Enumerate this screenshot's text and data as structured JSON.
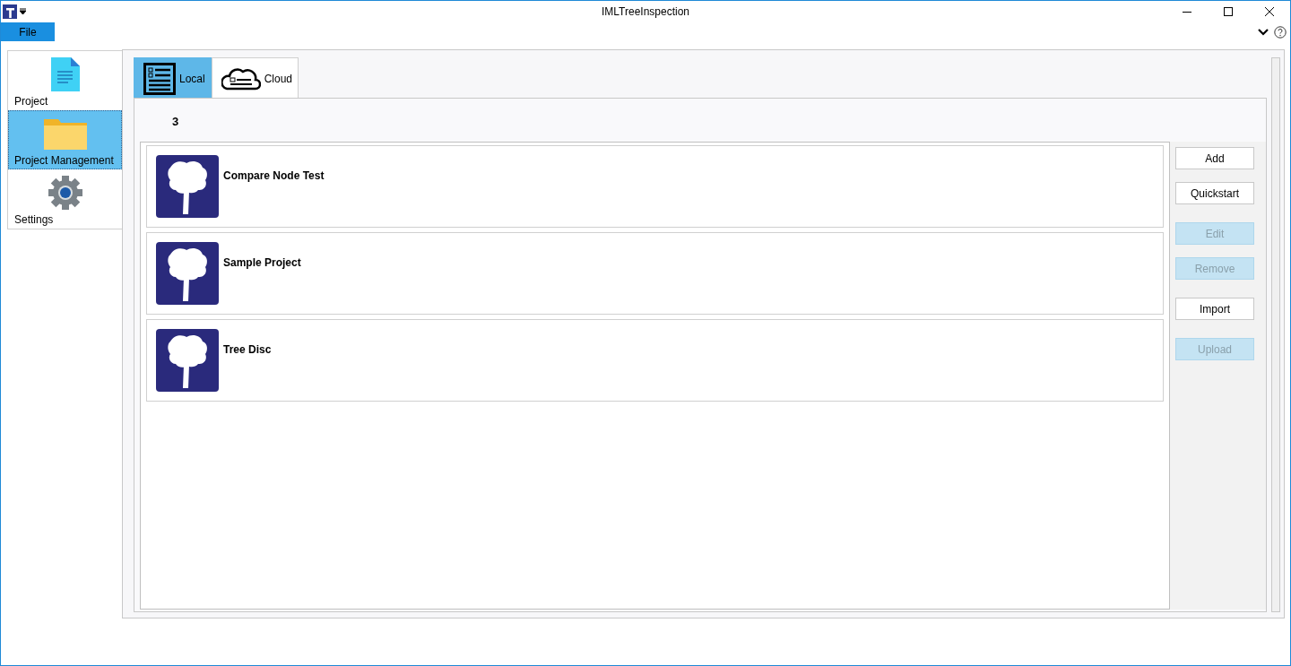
{
  "window": {
    "title": "IMLTreeInspection"
  },
  "menu": [
    {
      "label": "File",
      "selected": true
    }
  ],
  "sidebar": {
    "items": [
      {
        "kind": "document",
        "label": "Project",
        "selected": false
      },
      {
        "kind": "folder",
        "label": "Project Management",
        "selected": true
      },
      {
        "kind": "gear",
        "label": "Settings",
        "selected": false
      }
    ]
  },
  "tabs": [
    {
      "kind": "list",
      "label": "Local",
      "selected": true
    },
    {
      "kind": "cloud",
      "label": "Cloud",
      "selected": false
    }
  ],
  "count": "3",
  "projects": [
    {
      "name": "Compare Node Test"
    },
    {
      "name": "Sample Project"
    },
    {
      "name": "Tree Disc"
    }
  ],
  "button_groups": [
    [
      {
        "label": "Add",
        "disabled": false
      },
      {
        "label": "Quickstart",
        "disabled": false
      }
    ],
    [
      {
        "label": "Edit",
        "disabled": true
      },
      {
        "label": "Remove",
        "disabled": true
      }
    ],
    [
      {
        "label": "Import",
        "disabled": false
      }
    ],
    [
      {
        "label": "Upload",
        "disabled": true
      }
    ]
  ]
}
